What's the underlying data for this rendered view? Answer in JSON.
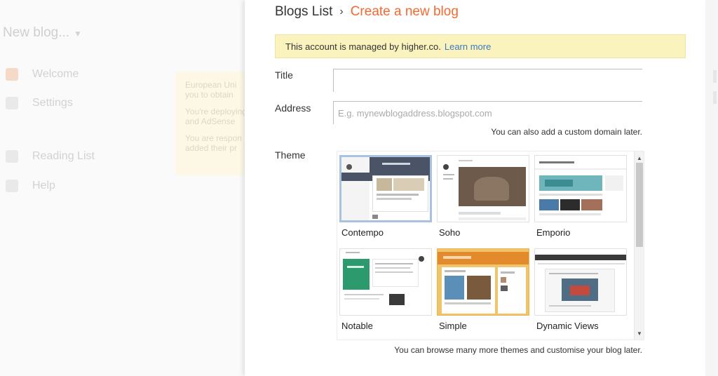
{
  "background": {
    "blog_title": "New blog...",
    "nav_items": [
      "Welcome",
      "Settings",
      "Reading List",
      "Help"
    ],
    "notice_lines": [
      "European Uni",
      "you to obtain",
      "You're deploying",
      "and AdSense",
      "You are respon",
      "added their pr"
    ]
  },
  "dialog": {
    "breadcrumb_parent": "Blogs List",
    "breadcrumb_separator": "›",
    "breadcrumb_current": "Create a new blog",
    "managed_notice": "This account is managed by higher.co.",
    "managed_link": "Learn more",
    "title_label": "Title",
    "title_value": "",
    "address_label": "Address",
    "address_placeholder": "E.g. mynewblogaddress.blogspot.com",
    "address_hint": "You can also add a custom domain later.",
    "theme_label": "Theme",
    "themes": [
      {
        "name": "Contempo",
        "selected": true
      },
      {
        "name": "Soho",
        "selected": false
      },
      {
        "name": "Emporio",
        "selected": false
      },
      {
        "name": "Notable",
        "selected": false
      },
      {
        "name": "Simple",
        "selected": false
      },
      {
        "name": "Dynamic Views",
        "selected": false
      }
    ],
    "theme_hint": "You can browse many more themes and customise your blog later."
  },
  "colors": {
    "accent_orange": "#f26a31",
    "link_blue": "#3b7abf",
    "notice_yellow": "#fbf3bd",
    "selected_border": "#a9c2e0"
  },
  "icons": {
    "scroll_up": "▲",
    "scroll_down": "▼"
  }
}
